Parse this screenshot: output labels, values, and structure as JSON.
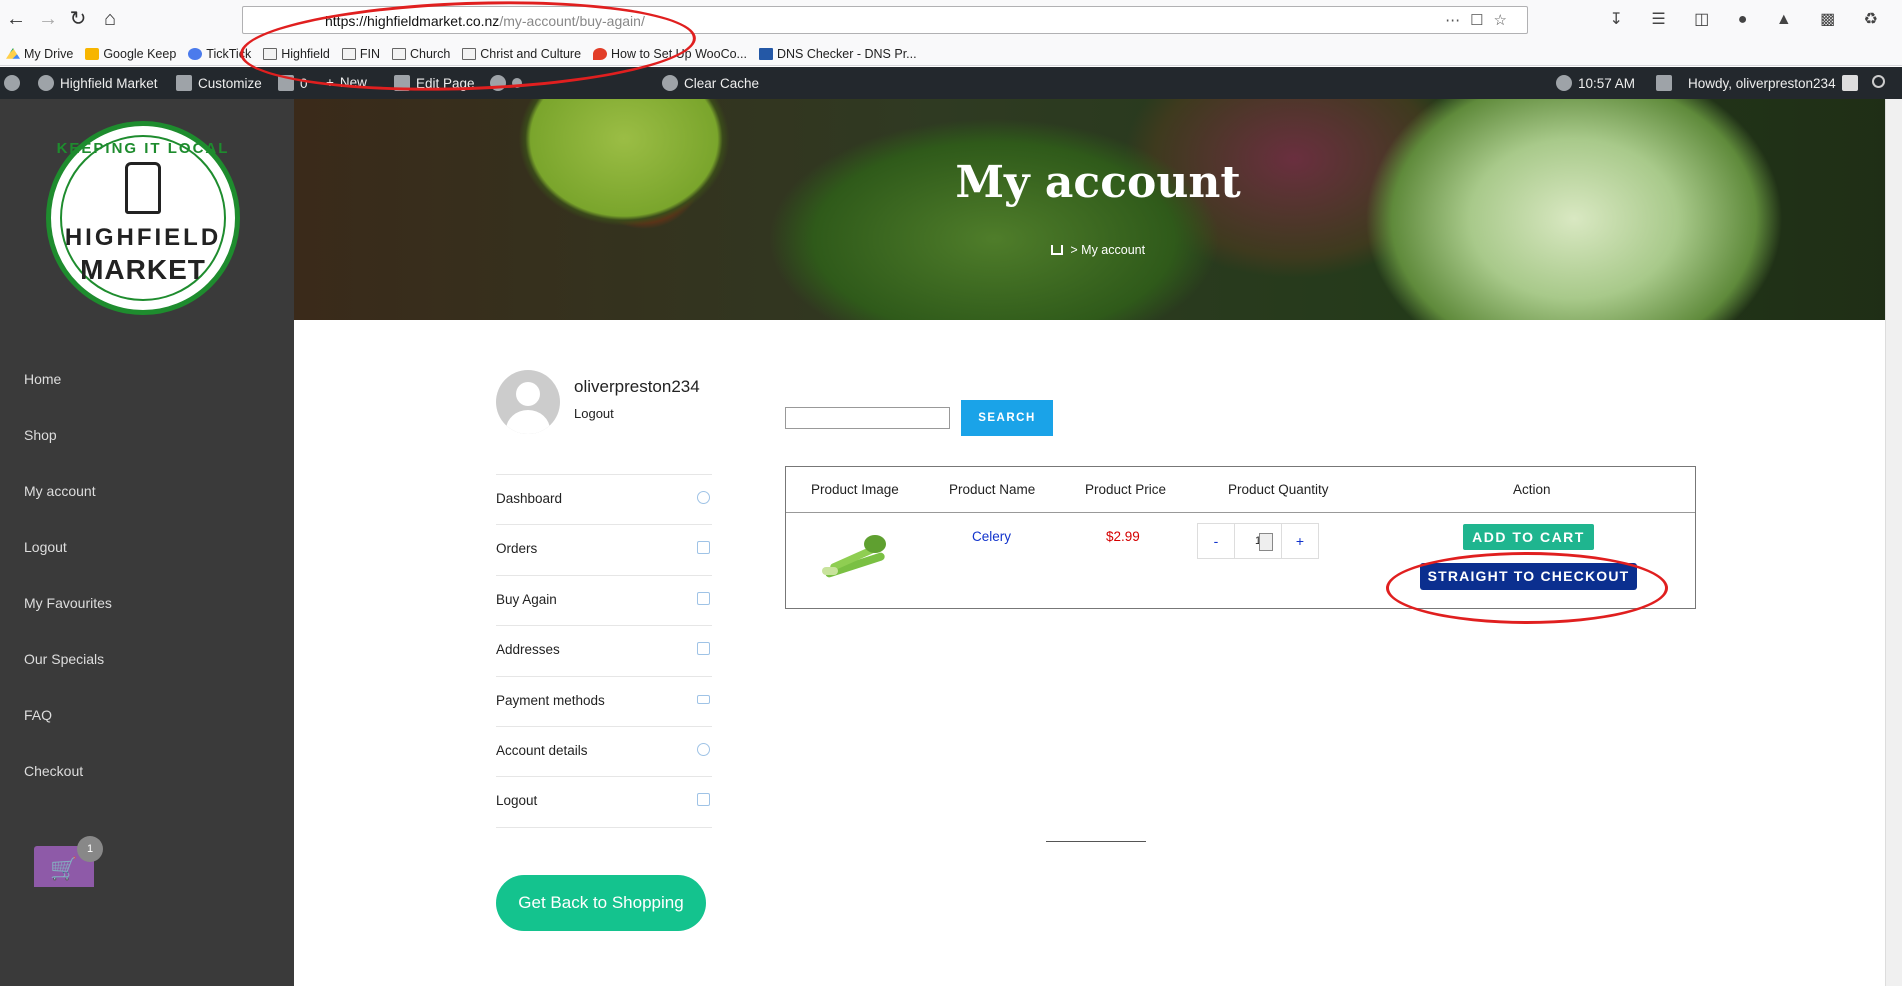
{
  "browser": {
    "url_domain": "https://highfieldmarket.co.nz",
    "url_path": "/my-account/buy-again/",
    "bookmarks": [
      "My Drive",
      "Google Keep",
      "TickTick",
      "Highfield",
      "FIN",
      "Church",
      "Christ and Culture",
      "How to Set Up WooCo...",
      "DNS Checker - DNS Pr..."
    ]
  },
  "wp_admin_bar": {
    "site_name": "Highfield Market",
    "customize": "Customize",
    "comments_count": "0",
    "new": "New",
    "edit_page": "Edit Page",
    "clear_cache": "Clear Cache",
    "time": "10:57 AM",
    "howdy": "Howdy, oliverpreston234"
  },
  "logo": {
    "top_text": "KEEPING IT LOCAL",
    "middle_text": "HIGHFIELD",
    "bottom_text": "MARKET"
  },
  "sidebar": {
    "items": [
      "Home",
      "Shop",
      "My account",
      "Logout",
      "My Favourites",
      "Our Specials",
      "FAQ",
      "Checkout"
    ],
    "cart_count": "1"
  },
  "hero": {
    "title": "My account",
    "breadcrumb_sep": ">",
    "breadcrumb_current": "My account"
  },
  "account": {
    "username": "oliverpreston234",
    "logout": "Logout",
    "menu": [
      {
        "label": "Dashboard",
        "icon": "dashboard-icon"
      },
      {
        "label": "Orders",
        "icon": "cart-icon"
      },
      {
        "label": "Buy Again",
        "icon": "document-icon"
      },
      {
        "label": "Addresses",
        "icon": "home-icon"
      },
      {
        "label": "Payment methods",
        "icon": "credit-card-icon"
      },
      {
        "label": "Account details",
        "icon": "user-icon"
      },
      {
        "label": "Logout",
        "icon": "logout-icon"
      }
    ],
    "back_button": "Get Back to Shopping"
  },
  "search": {
    "value": "",
    "button": "SEARCH"
  },
  "table": {
    "headers": [
      "Product Image",
      "Product Name",
      "Product Price",
      "Product Quantity",
      "Action"
    ],
    "rows": [
      {
        "name": "Celery",
        "price": "$2.99",
        "qty_minus": "-",
        "qty": "1",
        "qty_plus": "+",
        "add_to_cart": "ADD TO CART",
        "checkout": "STRAIGHT TO CHECKOUT"
      }
    ]
  },
  "colors": {
    "accent_green": "#14c38e",
    "search_blue": "#1aa3e8",
    "checkout_navy": "#0b2f8f",
    "annotation_red": "#e01f1f"
  }
}
